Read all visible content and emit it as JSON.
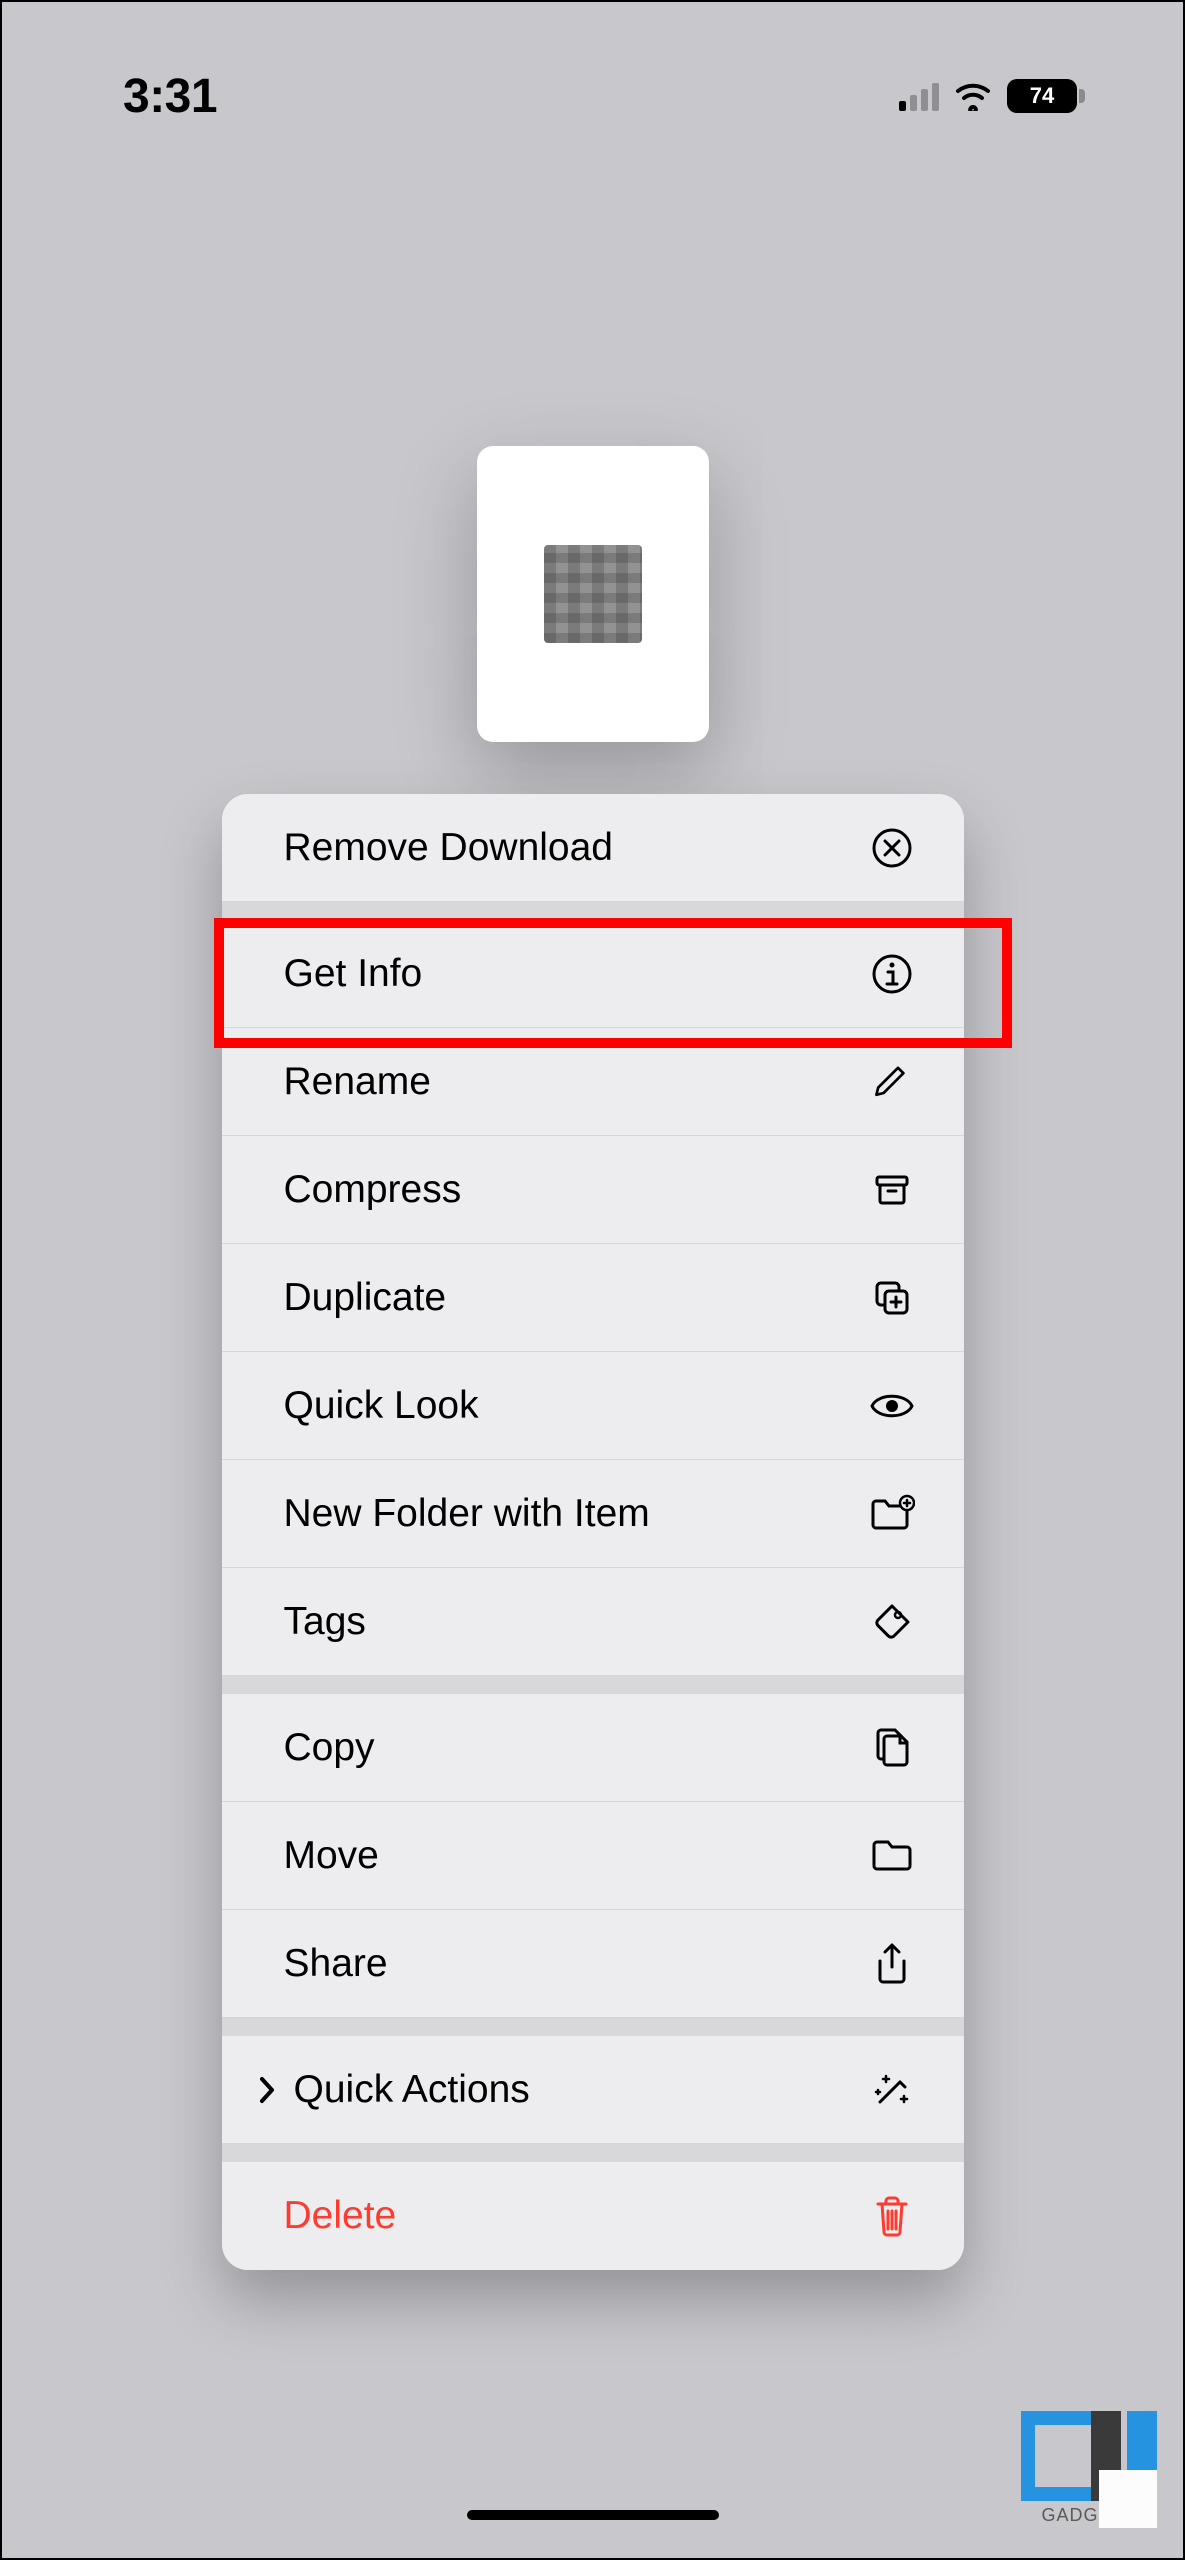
{
  "status": {
    "time": "3:31",
    "battery": "74"
  },
  "menu": {
    "remove_download": "Remove Download",
    "get_info": "Get Info",
    "rename": "Rename",
    "compress": "Compress",
    "duplicate": "Duplicate",
    "quick_look": "Quick Look",
    "new_folder": "New Folder with Item",
    "tags": "Tags",
    "copy": "Copy",
    "move": "Move",
    "share": "Share",
    "quick_actions": "Quick Actions",
    "delete": "Delete"
  },
  "watermark": {
    "text": "GADGETS"
  }
}
